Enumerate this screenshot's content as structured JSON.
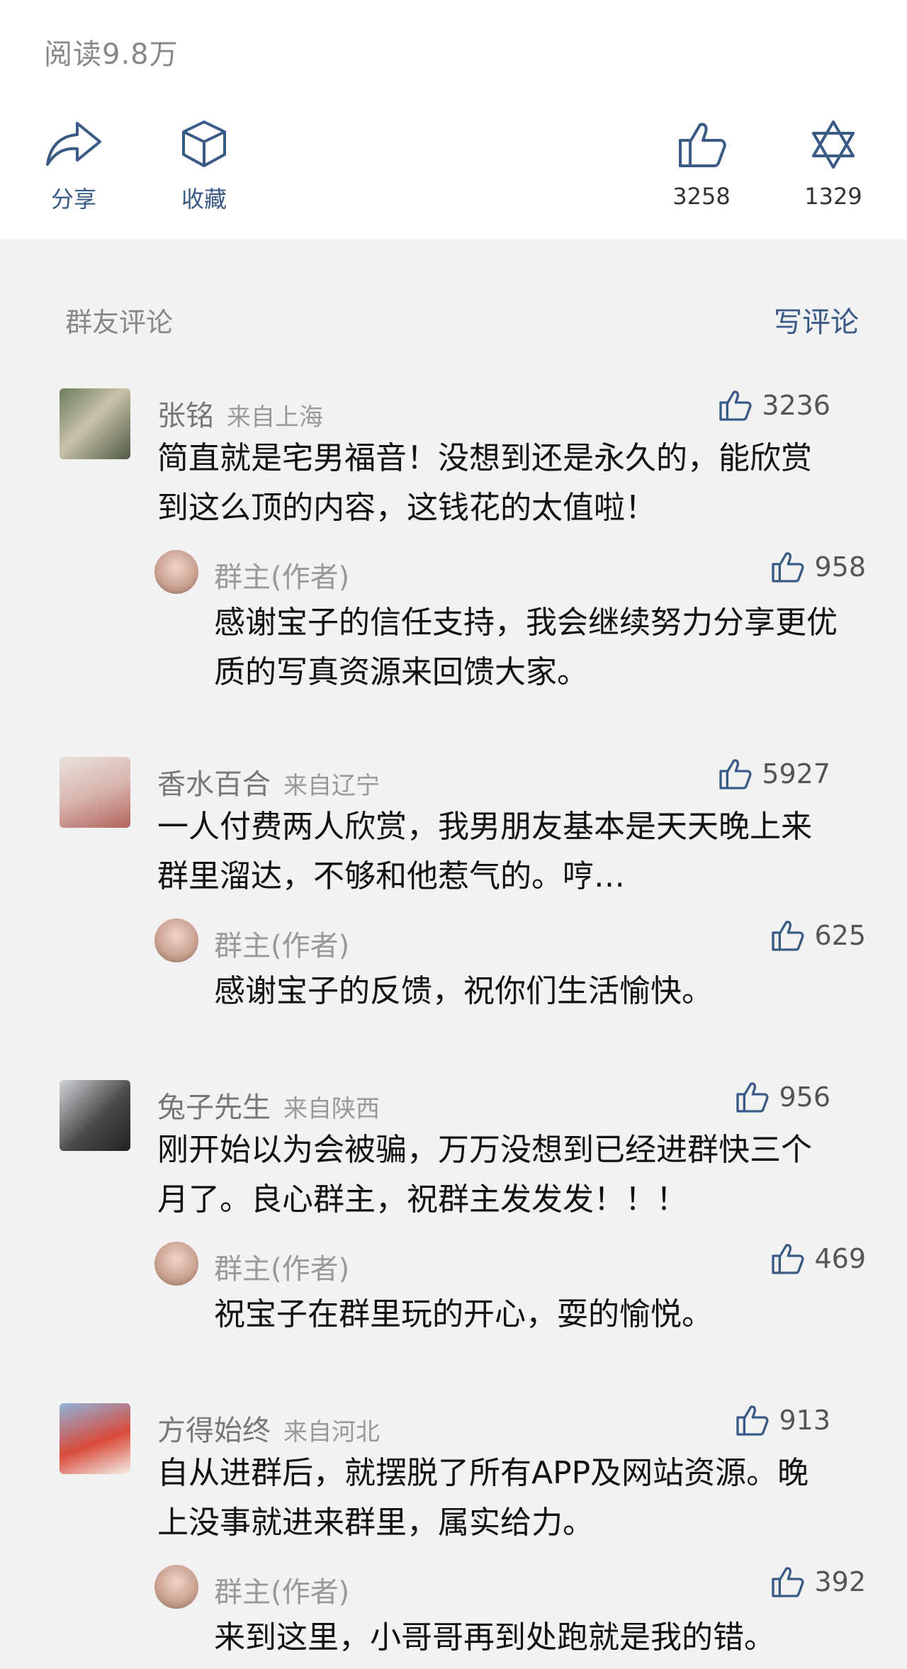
{
  "header": {
    "read_count": "阅读9.8万"
  },
  "actions": {
    "share_label": "分享",
    "collect_label": "收藏",
    "like_count": "3258",
    "star_count": "1329"
  },
  "comments_section": {
    "title": "群友评论",
    "write_label": "写评论"
  },
  "comments": [
    {
      "name": "张铭",
      "location": "来自上海",
      "likes": "3236",
      "text": "简直就是宅男福音！没想到还是永久的，能欣赏到这么顶的内容，这钱花的太值啦！",
      "reply": {
        "name": "群主(作者)",
        "likes": "958",
        "text": "感谢宝子的信任支持，我会继续努力分享更优质的写真资源来回馈大家。"
      }
    },
    {
      "name": "香水百合",
      "location": "来自辽宁",
      "likes": "5927",
      "text": "一人付费两人欣赏，我男朋友基本是天天晚上来群里溜达，不够和他惹气的。哼…",
      "reply": {
        "name": "群主(作者)",
        "likes": "625",
        "text": "感谢宝子的反馈，祝你们生活愉快。"
      }
    },
    {
      "name": "兔子先生",
      "location": "来自陕西",
      "likes": "956",
      "text": "刚开始以为会被骗，万万没想到已经进群快三个月了。良心群主，祝群主发发发！！！",
      "reply": {
        "name": "群主(作者)",
        "likes": "469",
        "text": "祝宝子在群里玩的开心，耍的愉悦。"
      }
    },
    {
      "name": "方得始终",
      "location": "来自河北",
      "likes": "913",
      "text": "自从进群后，就摆脱了所有APP及网站资源。晚上没事就进来群里，属实给力。",
      "reply": {
        "name": "群主(作者)",
        "likes": "392",
        "text": "来到这里，小哥哥再到处跑就是我的错。"
      }
    }
  ]
}
